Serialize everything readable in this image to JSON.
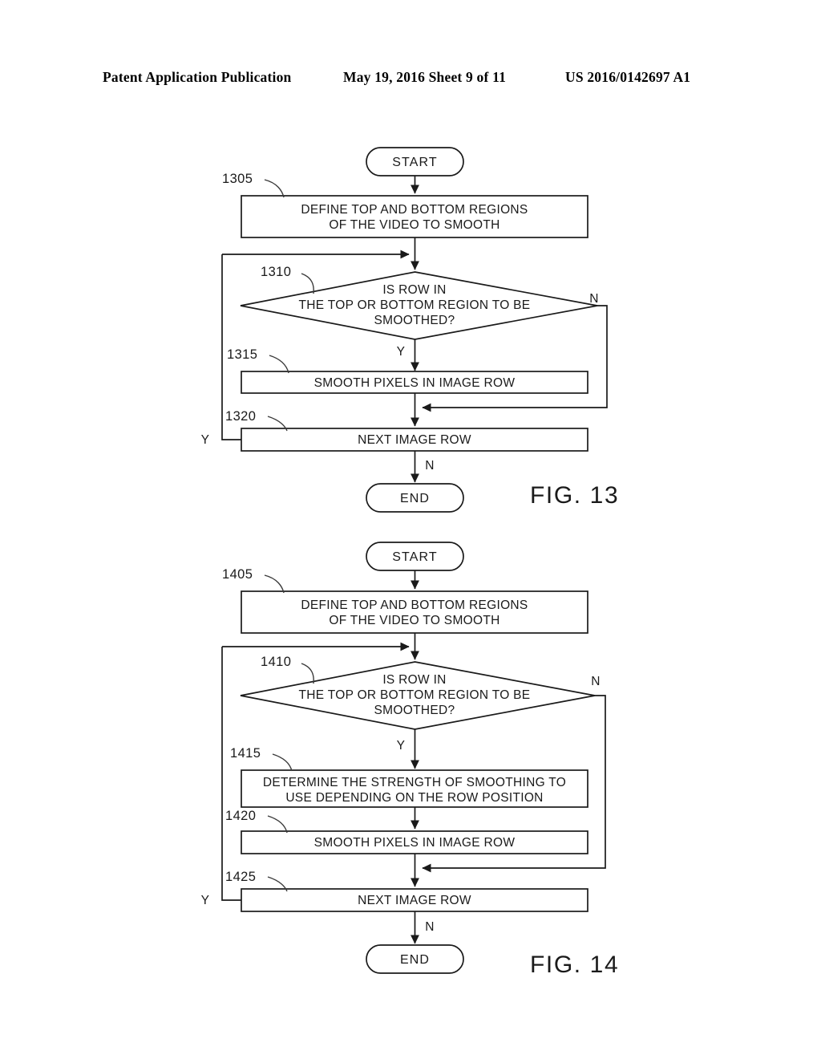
{
  "header": {
    "publication": "Patent Application Publication",
    "date_sheet": "May 19, 2016  Sheet 9 of 11",
    "pub_number": "US 2016/0142697 A1"
  },
  "figures": [
    {
      "id": "fig-13",
      "caption": "FIG. 13",
      "start_label": "START",
      "end_label": "END",
      "nodes": [
        {
          "ref": "1305",
          "type": "process",
          "lines": [
            "DEFINE TOP AND BOTTOM REGIONS",
            "OF THE VIDEO TO SMOOTH"
          ]
        },
        {
          "ref": "1310",
          "type": "decision",
          "lines": [
            "IS ROW IN",
            "THE TOP OR BOTTOM REGION TO BE",
            "SMOOTHED?"
          ]
        },
        {
          "ref": "1315",
          "type": "process",
          "lines": [
            "SMOOTH PIXELS IN IMAGE ROW"
          ]
        },
        {
          "ref": "1320",
          "type": "process",
          "lines": [
            "NEXT IMAGE ROW"
          ]
        }
      ],
      "branches": {
        "decision_yes": "Y",
        "decision_no": "N",
        "loop_yes": "Y",
        "exit_no": "N"
      }
    },
    {
      "id": "fig-14",
      "caption": "FIG. 14",
      "start_label": "START",
      "end_label": "END",
      "nodes": [
        {
          "ref": "1405",
          "type": "process",
          "lines": [
            "DEFINE TOP AND BOTTOM REGIONS",
            "OF THE VIDEO TO SMOOTH"
          ]
        },
        {
          "ref": "1410",
          "type": "decision",
          "lines": [
            "IS ROW IN",
            "THE TOP OR BOTTOM REGION TO BE",
            "SMOOTHED?"
          ]
        },
        {
          "ref": "1415",
          "type": "process",
          "lines": [
            "DETERMINE THE STRENGTH OF SMOOTHING TO",
            "USE DEPENDING ON THE ROW POSITION"
          ]
        },
        {
          "ref": "1420",
          "type": "process",
          "lines": [
            "SMOOTH PIXELS IN IMAGE ROW"
          ]
        },
        {
          "ref": "1425",
          "type": "process",
          "lines": [
            "NEXT IMAGE ROW"
          ]
        }
      ],
      "branches": {
        "decision_yes": "Y",
        "decision_no": "N",
        "loop_yes": "Y",
        "exit_no": "N"
      }
    }
  ]
}
